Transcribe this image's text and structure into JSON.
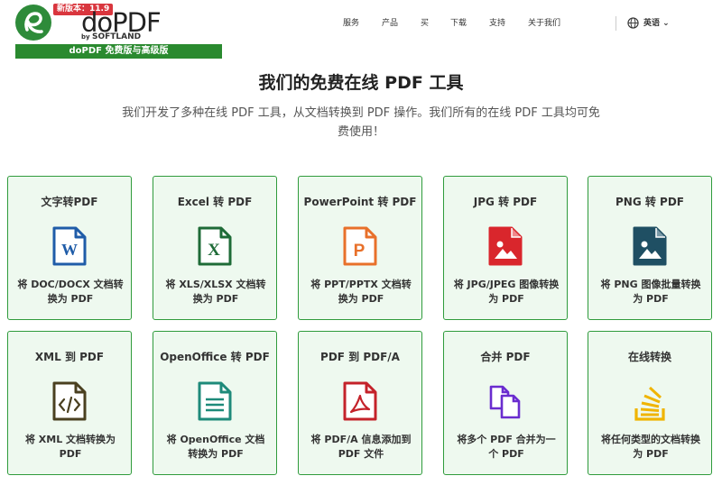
{
  "header": {
    "version_badge": "新版本：11.9",
    "brand_name": "doPDF",
    "brand_by": "by",
    "brand_company": "SOFTLAND",
    "pro_bar": "doPDF 免费版与高级版",
    "nav": [
      {
        "label": "服务"
      },
      {
        "label": "产品"
      },
      {
        "label": "买"
      },
      {
        "label": "下载"
      },
      {
        "label": "支持"
      },
      {
        "label": "关于我们"
      }
    ],
    "language": "英语"
  },
  "hero": {
    "title": "我们的免费在线 PDF 工具",
    "description": "我们开发了多种在线 PDF 工具，从文档转换到 PDF 操作。我们所有的在线 PDF 工具均可免费使用！"
  },
  "tools": [
    {
      "title": "文字转PDF",
      "desc": "将 DOC/DOCX 文档转换为 PDF",
      "icon": "word-file-icon",
      "color": "#1f5ca8"
    },
    {
      "title": "Excel 转 PDF",
      "desc": "将 XLS/XLSX 文档转换为 PDF",
      "icon": "excel-file-icon",
      "color": "#1e6b37"
    },
    {
      "title": "PowerPoint 转 PDF",
      "desc": "将 PPT/PPTX 文档转换为 PDF",
      "icon": "powerpoint-file-icon",
      "color": "#e8702a"
    },
    {
      "title": "JPG 转 PDF",
      "desc": "将 JPG/JPEG 图像转换为 PDF",
      "icon": "jpg-image-icon",
      "color": "#d9262c"
    },
    {
      "title": "PNG 转 PDF",
      "desc": "将 PNG 图像批量转换为 PDF",
      "icon": "png-image-icon",
      "color": "#1f4f63"
    },
    {
      "title": "XML 到 PDF",
      "desc": "将 XML 文档转换为 PDF",
      "icon": "xml-code-icon",
      "color": "#4a4020"
    },
    {
      "title": "OpenOffice 转 PDF",
      "desc": "将 OpenOffice 文档转换为 PDF",
      "icon": "openoffice-document-icon",
      "color": "#1e8a7a"
    },
    {
      "title": "PDF 到 PDF/A",
      "desc": "将 PDF/A 信息添加到 PDF 文件",
      "icon": "pdfa-file-icon",
      "color": "#c4222a"
    },
    {
      "title": "合并 PDF",
      "desc": "将多个 PDF 合并为一个 PDF",
      "icon": "merge-files-icon",
      "color": "#6a2ccf"
    },
    {
      "title": "在线转换",
      "desc": "将任何类型的文档转换为 PDF",
      "icon": "stack-convert-icon",
      "color": "#f0b400"
    }
  ]
}
